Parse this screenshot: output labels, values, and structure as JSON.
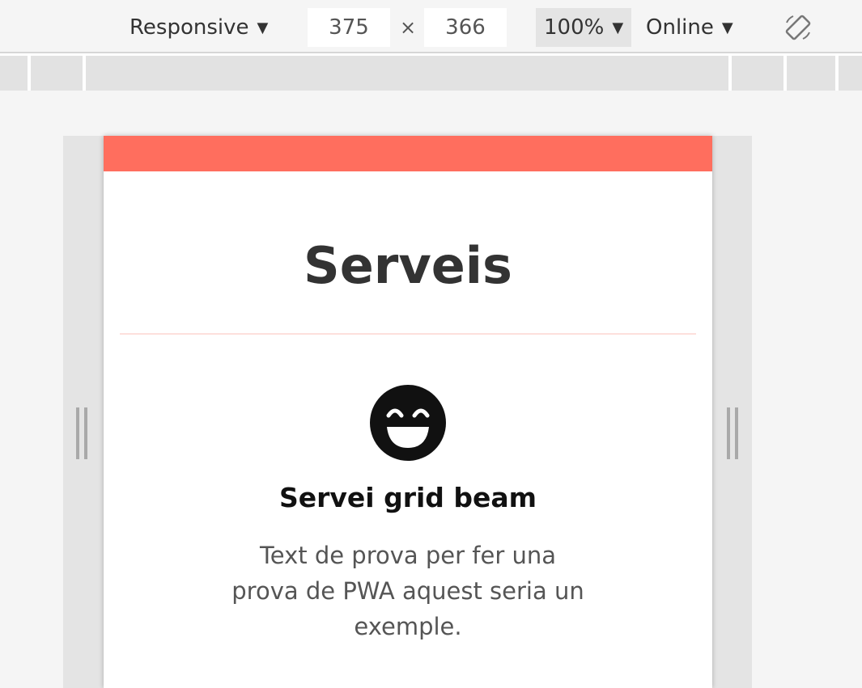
{
  "toolbar": {
    "device_mode": "Responsive",
    "width": "375",
    "times": "×",
    "height": "366",
    "zoom": "100%",
    "throttling": "Online",
    "dropdown_arrow": "▼",
    "rotate_icon": "rotate-icon"
  },
  "page": {
    "header_color": "#ff6e5e",
    "section_title": "Serveis",
    "service": {
      "icon": "grinning-face-icon",
      "title": "Servei grid beam",
      "description": "Text de prova per fer una prova de PWA aquest seria un exemple."
    }
  }
}
